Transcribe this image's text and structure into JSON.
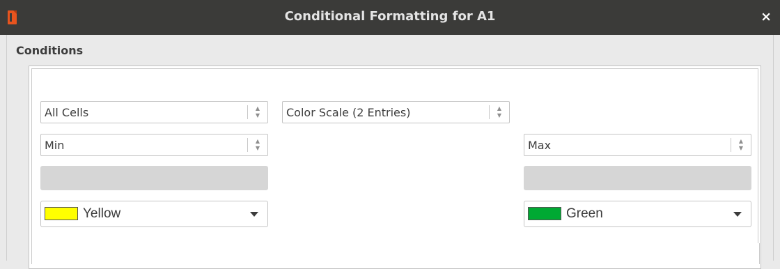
{
  "window": {
    "title": "Conditional Formatting for A1",
    "close_glyph": "×",
    "app_icon": "office-document-icon",
    "accent_color": "#e8541e"
  },
  "conditions": {
    "section_label": "Conditions",
    "range_select": {
      "value": "All Cells"
    },
    "type_select": {
      "value": "Color Scale (2 Entries)"
    },
    "min_entry": {
      "type_value": "Min",
      "value_field": "",
      "color": {
        "name": "Yellow",
        "hex": "#ffff00"
      }
    },
    "max_entry": {
      "type_value": "Max",
      "value_field": "",
      "color": {
        "name": "Green",
        "hex": "#00a933"
      }
    }
  }
}
